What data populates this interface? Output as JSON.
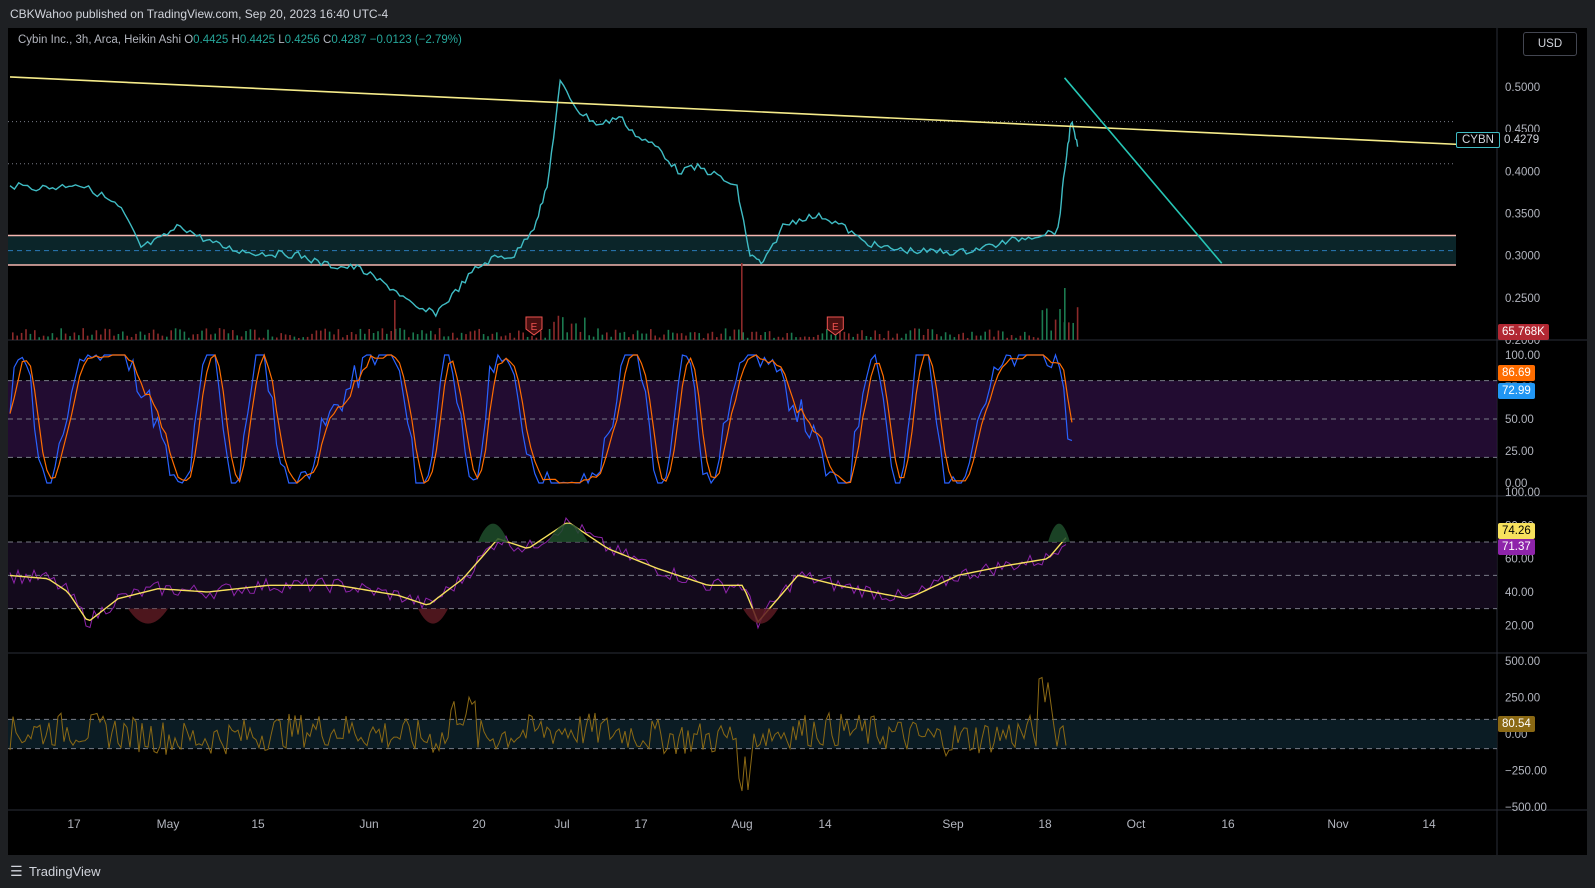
{
  "header": {
    "published": "CBKWahoo published on TradingView.com, Sep 20, 2023 16:40 UTC-4"
  },
  "footer": {
    "brand": "TradingView"
  },
  "legend": {
    "symbol": "Cybin Inc., 3h, Arca, Heikin Ashi",
    "o_label": "O",
    "o": "0.4425",
    "h_label": "H",
    "h": "0.4425",
    "l_label": "L",
    "l": "0.4256",
    "c_label": "C",
    "c": "0.4287",
    "change": "−0.0123 (−2.79%)"
  },
  "currency_button": "USD",
  "colors": {
    "background": "#000000",
    "up": "#26a69a",
    "down": "#ef5350",
    "price_line": "#3fbcc4",
    "trendline_yellow": "#f5eb8a",
    "trendline_teal": "#26c6b5",
    "band_edge": "#f4b6b0",
    "band_fill": "#0d2b30",
    "stoch_k": "#2962ff",
    "stoch_d": "#ff6d00",
    "stoch_band": "#2a0f3d",
    "rsi": "#8e24aa",
    "rsi_ma": "#f7e15d",
    "cci": "#8b6914"
  },
  "chart_data": [
    {
      "type": "line",
      "name": "price",
      "symbol": "CYBN",
      "style": "Heikin Ashi",
      "ylim": [
        0.2,
        0.525
      ],
      "y_ticks": [
        "0.5000",
        "0.4500",
        "0.4000",
        "0.3500",
        "0.3000",
        "0.2500",
        "0.2000"
      ],
      "x_labels": [
        "17",
        "May",
        "15",
        "Jun",
        "20",
        "Jul",
        "17",
        "Aug",
        "14",
        "Sep",
        "18",
        "Oct",
        "16",
        "Nov",
        "14"
      ],
      "points": [
        [
          "Apr 10",
          0.383
        ],
        [
          "Apr 14",
          0.381
        ],
        [
          "Apr 17",
          0.381
        ],
        [
          "Apr 20",
          0.386
        ],
        [
          "Apr 24",
          0.372
        ],
        [
          "Apr 27",
          0.355
        ],
        [
          "Apr 30",
          0.31
        ],
        [
          "May 3",
          0.32
        ],
        [
          "May 6",
          0.336
        ],
        [
          "May 9",
          0.322
        ],
        [
          "May 12",
          0.312
        ],
        [
          "May 15",
          0.306
        ],
        [
          "May 18",
          0.303
        ],
        [
          "May 21",
          0.302
        ],
        [
          "May 24",
          0.301
        ],
        [
          "May 27",
          0.292
        ],
        [
          "May 30",
          0.287
        ],
        [
          "Jun 2",
          0.286
        ],
        [
          "Jun 5",
          0.272
        ],
        [
          "Jun 8",
          0.258
        ],
        [
          "Jun 11",
          0.237
        ],
        [
          "Jun 14",
          0.232
        ],
        [
          "Jun 17",
          0.257
        ],
        [
          "Jun 20",
          0.284
        ],
        [
          "Jun 23",
          0.298
        ],
        [
          "Jun 26",
          0.3
        ],
        [
          "Jun 29",
          0.335
        ],
        [
          "Jul 1",
          0.38
        ],
        [
          "Jul 3",
          0.505
        ],
        [
          "Jul 6",
          0.47
        ],
        [
          "Jul 9",
          0.455
        ],
        [
          "Jul 12",
          0.465
        ],
        [
          "Jul 15",
          0.44
        ],
        [
          "Jul 18",
          0.428
        ],
        [
          "Jul 21",
          0.4
        ],
        [
          "Jul 24",
          0.405
        ],
        [
          "Jul 27",
          0.395
        ],
        [
          "Jul 30",
          0.38
        ],
        [
          "Aug 1",
          0.3
        ],
        [
          "Aug 3",
          0.29
        ],
        [
          "Aug 6",
          0.335
        ],
        [
          "Aug 9",
          0.345
        ],
        [
          "Aug 12",
          0.347
        ],
        [
          "Aug 15",
          0.336
        ],
        [
          "Aug 18",
          0.318
        ],
        [
          "Aug 21",
          0.31
        ],
        [
          "Aug 24",
          0.307
        ],
        [
          "Aug 27",
          0.305
        ],
        [
          "Aug 30",
          0.305
        ],
        [
          "Sep 2",
          0.304
        ],
        [
          "Sep 5",
          0.309
        ],
        [
          "Sep 8",
          0.314
        ],
        [
          "Sep 11",
          0.32
        ],
        [
          "Sep 14",
          0.325
        ],
        [
          "Sep 17",
          0.33
        ],
        [
          "Sep 18",
          0.4
        ],
        [
          "Sep 19",
          0.46
        ],
        [
          "Sep 20",
          0.4279
        ]
      ],
      "current_price_label": "0.4279",
      "volume_label": "65.768K",
      "dotted_levels": [
        0.459,
        0.409
      ],
      "support_zone": {
        "top": 0.324,
        "mid": 0.306,
        "bottom": 0.289
      },
      "trendlines": [
        {
          "color": "yellow",
          "from": [
            "Apr 10",
            0.512
          ],
          "to": [
            "Nov 20",
            0.431
          ]
        },
        {
          "color": "teal",
          "from": [
            "Sep 18",
            0.511
          ],
          "to": [
            "Oct 12",
            0.291
          ]
        }
      ],
      "earnings_markers": [
        "Jun 29",
        "Aug 14"
      ],
      "earnings_marker_text": "E"
    },
    {
      "type": "line",
      "name": "stochastic",
      "ylim": [
        0,
        100
      ],
      "y_ticks": [
        "100.00",
        "75.00",
        "50.00",
        "25.00",
        "0.00"
      ],
      "bands": [
        80,
        20
      ],
      "labels": {
        "k": "86.69",
        "d": "72.99"
      }
    },
    {
      "type": "line",
      "name": "rsi",
      "ylim": [
        10,
        100
      ],
      "y_ticks": [
        "100.00",
        "80.00",
        "60.00",
        "40.00",
        "20.00"
      ],
      "bands": [
        70,
        30
      ],
      "labels": {
        "ma": "74.26",
        "rsi": "71.37"
      }
    },
    {
      "type": "line",
      "name": "cci",
      "ylim": [
        -520,
        520
      ],
      "y_ticks": [
        "500.00",
        "250.00",
        "0.00",
        "−250.00",
        "−500.00"
      ],
      "bands": [
        100,
        -100
      ],
      "label": "80.54"
    }
  ]
}
